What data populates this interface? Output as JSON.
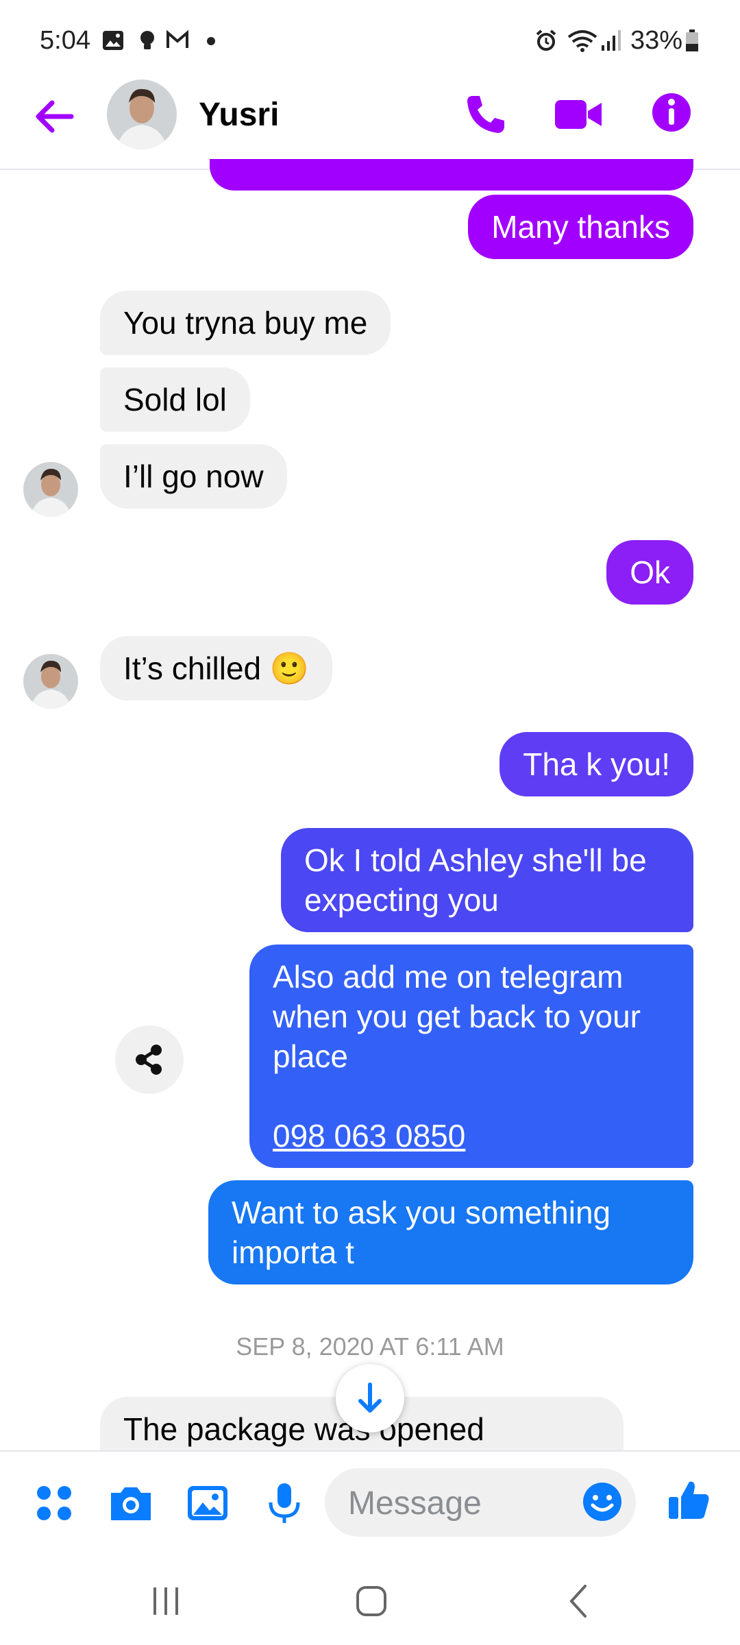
{
  "status_bar": {
    "time": "5:04",
    "battery": "33%",
    "icons": [
      "image-icon",
      "bulb-icon",
      "gmail-icon",
      "dot-icon",
      "alarm-icon",
      "wifi-icon",
      "signal-icon",
      "battery-icon"
    ]
  },
  "header": {
    "contact_name": "Yusri",
    "icons": [
      "back-arrow-icon",
      "phone-icon",
      "video-camera-icon",
      "info-icon"
    ]
  },
  "messages": [
    {
      "dir": "out",
      "text": "Many thanks"
    },
    {
      "dir": "in",
      "text": "You tryna buy me"
    },
    {
      "dir": "in",
      "text": "Sold lol"
    },
    {
      "dir": "in",
      "text": "I’ll go now"
    },
    {
      "dir": "out",
      "text": "Ok"
    },
    {
      "dir": "in",
      "text": "It’s chilled 🙂"
    },
    {
      "dir": "out",
      "text": "Tha k you!"
    },
    {
      "dir": "out",
      "text": "Ok I told Ashley she'll be expecting you"
    },
    {
      "dir": "out",
      "text": "Also add me on telegram when you get back to your place",
      "link": "098 063 0850"
    },
    {
      "dir": "out",
      "text": "Want to ask you something importa t"
    },
    {
      "dir": "in",
      "text": "The package was opened"
    }
  ],
  "date_separator": "SEP 8, 2020 AT 6:11 AM",
  "composer": {
    "placeholder": "Message",
    "icons": [
      "menu-dots-icon",
      "camera-icon",
      "gallery-icon",
      "microphone-icon",
      "emoji-icon",
      "thumbs-up-icon"
    ]
  },
  "nav_bar": {
    "icons": [
      "recent-apps-icon",
      "home-icon",
      "back-icon"
    ]
  },
  "colors": {
    "accent_purple": "#a100ff",
    "bubble_purple": "#8b1ff5",
    "bubble_violet": "#5f3df5",
    "bubble_indigo": "#4b47f2",
    "bubble_blue": "#3360f7",
    "bubble_bright_blue": "#1877f2",
    "incoming_gray": "#f0f0f0",
    "messenger_blue": "#0a7cff"
  }
}
